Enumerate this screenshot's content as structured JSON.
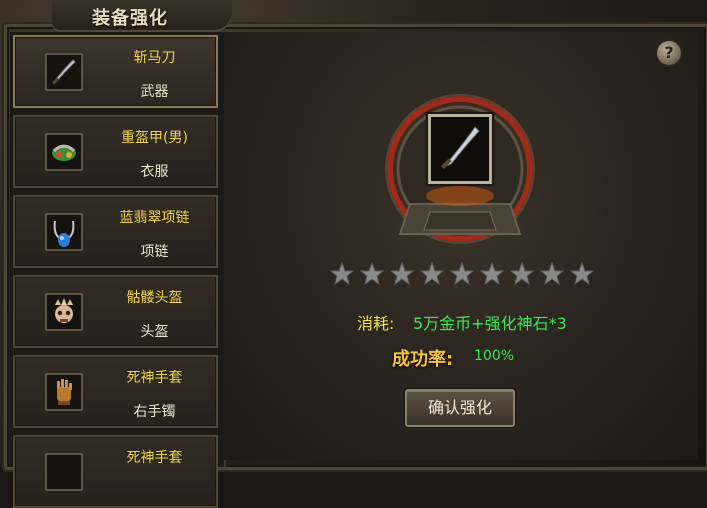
{
  "window": {
    "title": "装备强化"
  },
  "equipment_list": [
    {
      "name": "斩马刀",
      "type": "武器",
      "icon": "sword-icon",
      "selected": true
    },
    {
      "name": "重盔甲(男)",
      "type": "衣服",
      "icon": "armor-icon",
      "selected": false
    },
    {
      "name": "蓝翡翠项链",
      "type": "项链",
      "icon": "necklace-icon",
      "selected": false
    },
    {
      "name": "骷髅头盔",
      "type": "头盔",
      "icon": "skull-helmet-icon",
      "selected": false
    },
    {
      "name": "死神手套",
      "type": "右手镯",
      "icon": "gauntlet-icon",
      "selected": false
    },
    {
      "name": "死神手套",
      "type": "",
      "icon": "gauntlet-icon",
      "selected": false
    }
  ],
  "help_button": {
    "label": "?"
  },
  "enhance": {
    "stars_total": 9,
    "stars_filled": 0,
    "cost_label": "消耗:",
    "cost_value": "5万金币+强化神石*3",
    "rate_label": "成功率:",
    "rate_value": "100%",
    "confirm_label": "确认强化"
  },
  "colors": {
    "name_text": "#f1d54a",
    "cost_value": "#3ee65a",
    "rate_label": "#f6c33a",
    "star_empty": "#8a8a8a"
  }
}
